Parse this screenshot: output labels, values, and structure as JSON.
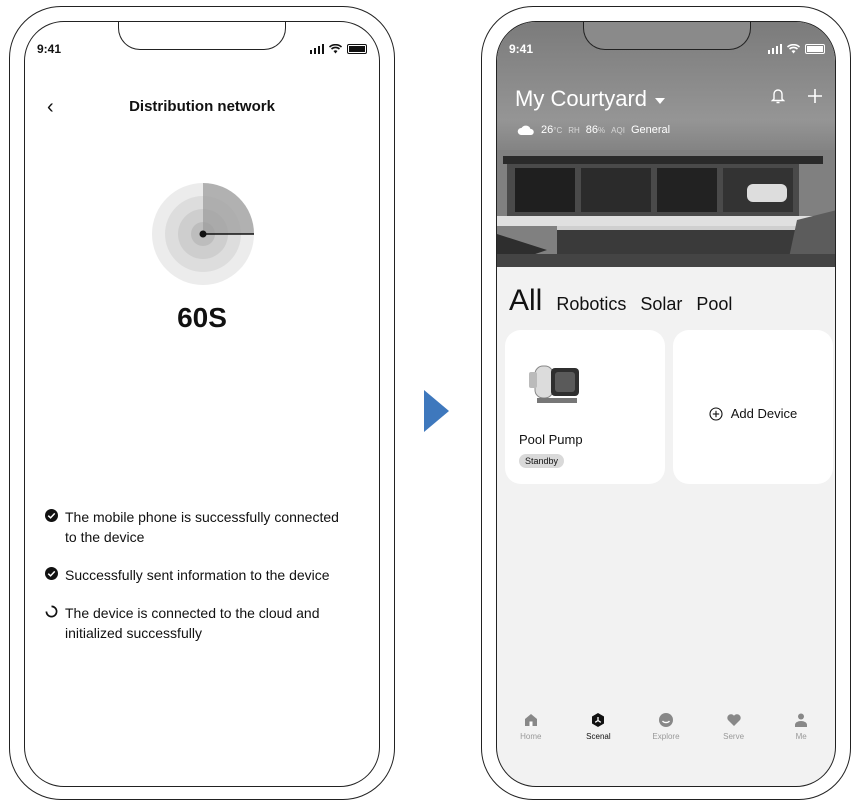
{
  "left_screen": {
    "status_time": "9:41",
    "nav_title": "Distribution network",
    "countdown": "60S",
    "steps": [
      {
        "text": "The mobile phone is successfully connected to the device",
        "state": "done"
      },
      {
        "text": "Successfully sent information to the device",
        "state": "done"
      },
      {
        "text": "The device is connected to the cloud and initialized successfully",
        "state": "loading"
      }
    ]
  },
  "right_screen": {
    "status_time": "9:41",
    "home_title": "My Courtyard",
    "weather": {
      "temp": "26",
      "temp_unit": "°C",
      "rh_label": "RH",
      "rh": "86",
      "rh_unit": "%",
      "aqi_label": "AQI",
      "aqi_value": "General"
    },
    "tabs": [
      {
        "label": "All",
        "active": true
      },
      {
        "label": "Robotics",
        "active": false
      },
      {
        "label": "Solar",
        "active": false
      },
      {
        "label": "Pool",
        "active": false
      }
    ],
    "device_card": {
      "name": "Pool Pump",
      "status": "Standby"
    },
    "add_device_label": "Add Device",
    "tabbar": [
      {
        "label": "Home",
        "icon": "home-icon",
        "active": false
      },
      {
        "label": "Scenal",
        "icon": "scenal-icon",
        "active": true
      },
      {
        "label": "Explore",
        "icon": "explore-icon",
        "active": false
      },
      {
        "label": "Serve",
        "icon": "heart-icon",
        "active": false
      },
      {
        "label": "Me",
        "icon": "person-icon",
        "active": false
      }
    ]
  },
  "colors": {
    "arrow": "#3e78bd",
    "badge_bg": "#d9d9d9",
    "screen_bg": "#f2f2f2"
  }
}
